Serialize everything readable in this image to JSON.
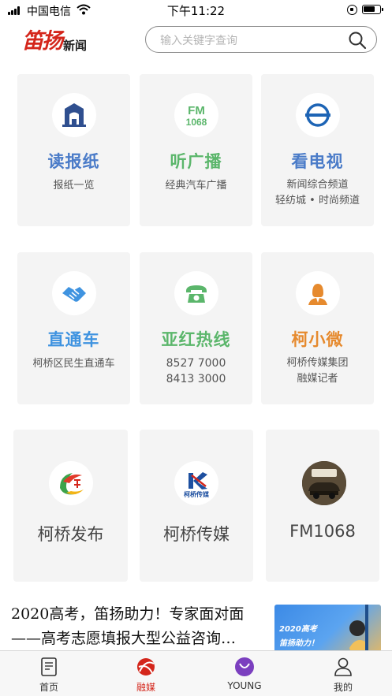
{
  "status_bar": {
    "carrier": "中国电信",
    "time": "下午11:22"
  },
  "header": {
    "logo_main": "笛扬",
    "logo_sub": "新闻",
    "search_placeholder": "输入关键字查询"
  },
  "colors": {
    "blue": "#4a7bc8",
    "green": "#5bb66b",
    "sky": "#3f93e0",
    "orange": "#e68a2e",
    "brand_red": "#d4261b"
  },
  "cards": [
    {
      "title": "读报纸",
      "lines": [
        "报纸一览"
      ],
      "icon": "newspaper-building-icon"
    },
    {
      "title": "听广播",
      "lines": [
        "经典汽车广播"
      ],
      "icon": "fm1068-radio-icon"
    },
    {
      "title": "看电视",
      "lines": [
        "新闻综合频道",
        "轻纺城 • 时尚频道"
      ],
      "icon": "tv-station-icon"
    },
    {
      "title": "直通车",
      "lines": [
        "柯桥区民生直通车"
      ],
      "icon": "handshake-icon"
    },
    {
      "title": "亚红热线",
      "lines": [
        "8527 7000",
        "8413 3000"
      ],
      "icon": "telephone-icon"
    },
    {
      "title": "柯小微",
      "lines": [
        "柯桥传媒集团",
        "融媒记者"
      ],
      "icon": "reporter-avatar-icon"
    },
    {
      "title": "柯桥发布",
      "lines": [],
      "icon": "keqiao-release-logo-icon"
    },
    {
      "title": "柯桥传媒",
      "lines": [],
      "icon": "keqiao-media-logo-icon",
      "logo_text": "柯桥传媒"
    },
    {
      "title": "FM1068",
      "lines": [],
      "icon": "fm1068-car-photo-icon"
    }
  ],
  "fm_icon_text": {
    "top": "FM",
    "bottom": "1068"
  },
  "news": {
    "headline": "2020高考，笛扬助力！专家面对面——高考志愿填报大型公益咨询…",
    "thumb_line1": "2020高考",
    "thumb_line2": "笛扬助力！"
  },
  "tabs": [
    {
      "label": "首页",
      "icon": "home-news-icon",
      "active": false
    },
    {
      "label": "融媒",
      "icon": "rongmei-icon",
      "active": true
    },
    {
      "label": "YOUNG",
      "icon": "young-icon",
      "active": false
    },
    {
      "label": "我的",
      "icon": "profile-icon",
      "active": false
    }
  ]
}
